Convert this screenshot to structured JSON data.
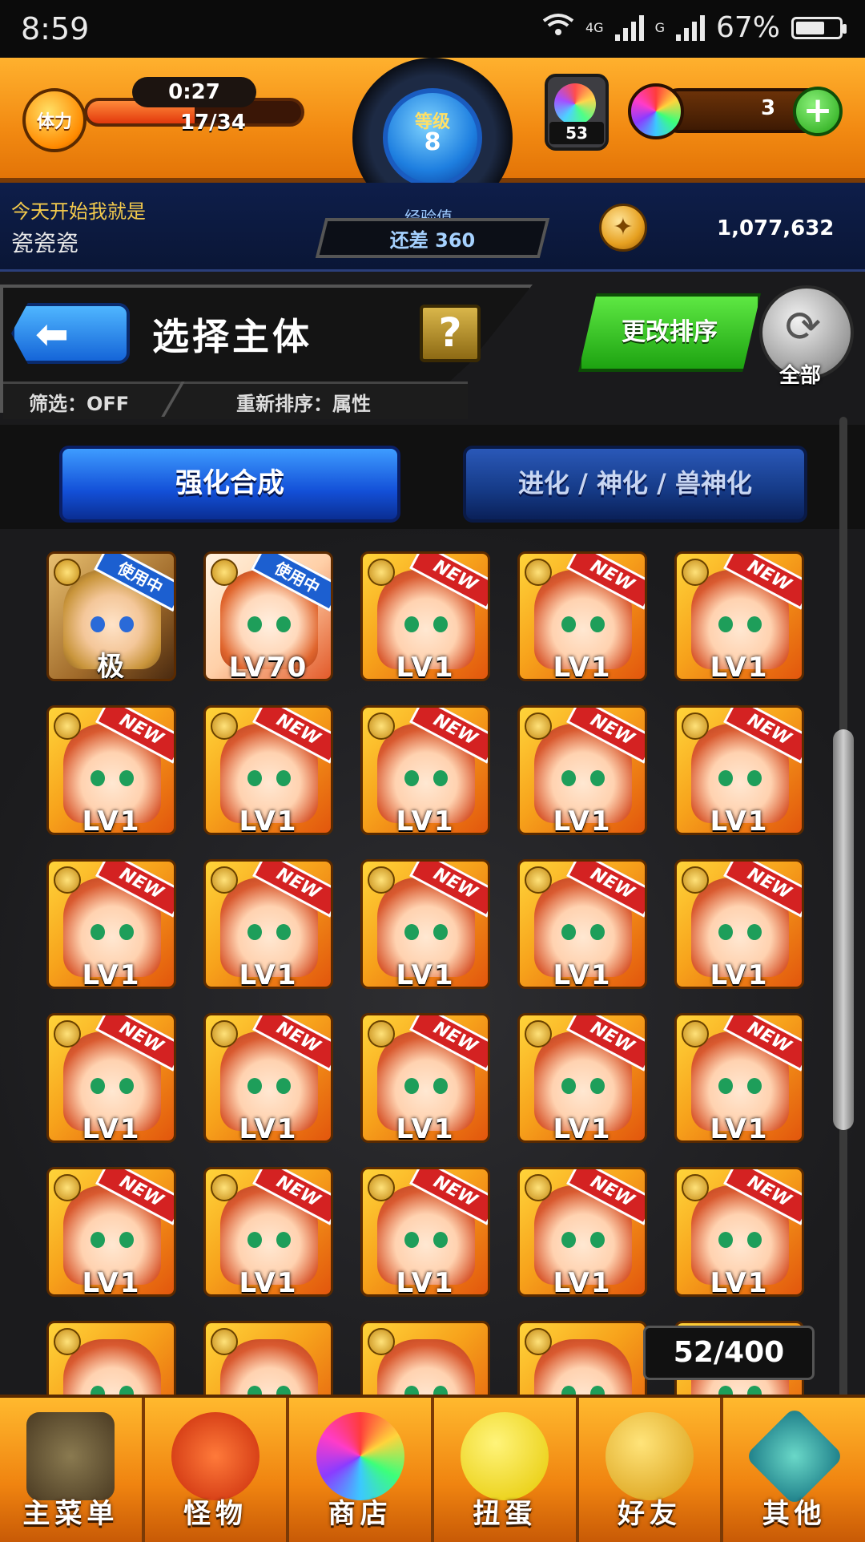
{
  "status_bar": {
    "time": "8:59",
    "network": "4G",
    "signal_label": "G",
    "battery": "67%",
    "battery_level": 0.67
  },
  "header": {
    "stamina_label": "体力",
    "stamina_timer": "0:27",
    "stamina": "17/34",
    "stamina_fraction": 0.5,
    "level_label": "等级",
    "level": "8",
    "exp_label": "经验值",
    "exp_remaining": "还差 360",
    "potion_count": "53",
    "orb_count": "3",
    "orb_add": "+",
    "coins": "1,077,632"
  },
  "profile": {
    "motto": "今天开始我就是",
    "name": "瓷瓷瓷"
  },
  "panel": {
    "back_icon": "back-arrow-icon",
    "title": "选择主体",
    "help": "?",
    "filter": "筛选：OFF",
    "sort": "重新排序：属性",
    "change_sort": "更改排序",
    "sort_all": "全部"
  },
  "modes": {
    "enhance": "强化合成",
    "evolve": "进化 / 神化 / 兽神化"
  },
  "grid": {
    "cards": [
      {
        "label": "极",
        "badge": "使用中",
        "type": "hero1"
      },
      {
        "label": "LV70",
        "badge": "使用中",
        "type": "hero2"
      },
      {
        "label": "LV1",
        "badge": "NEW"
      },
      {
        "label": "LV1",
        "badge": "NEW"
      },
      {
        "label": "LV1",
        "badge": "NEW"
      },
      {
        "label": "LV1",
        "badge": "NEW"
      },
      {
        "label": "LV1",
        "badge": "NEW"
      },
      {
        "label": "LV1",
        "badge": "NEW"
      },
      {
        "label": "LV1",
        "badge": "NEW"
      },
      {
        "label": "LV1",
        "badge": "NEW"
      },
      {
        "label": "LV1",
        "badge": "NEW"
      },
      {
        "label": "LV1",
        "badge": "NEW"
      },
      {
        "label": "LV1",
        "badge": "NEW"
      },
      {
        "label": "LV1",
        "badge": "NEW"
      },
      {
        "label": "LV1",
        "badge": "NEW"
      },
      {
        "label": "LV1",
        "badge": "NEW"
      },
      {
        "label": "LV1",
        "badge": "NEW"
      },
      {
        "label": "LV1",
        "badge": "NEW"
      },
      {
        "label": "LV1",
        "badge": "NEW"
      },
      {
        "label": "LV1",
        "badge": "NEW"
      },
      {
        "label": "LV1",
        "badge": "NEW"
      },
      {
        "label": "LV1",
        "badge": "NEW"
      },
      {
        "label": "LV1",
        "badge": "NEW"
      },
      {
        "label": "LV1",
        "badge": "NEW"
      },
      {
        "label": "LV1",
        "badge": "NEW"
      },
      {
        "label": "",
        "badge": ""
      },
      {
        "label": "",
        "badge": ""
      },
      {
        "label": "",
        "badge": ""
      },
      {
        "label": "",
        "badge": ""
      },
      {
        "label": "",
        "badge": ""
      }
    ],
    "box_count": "52/400"
  },
  "nav": [
    {
      "id": "home",
      "label": "主菜单",
      "icon": "gate-icon"
    },
    {
      "id": "monster",
      "label": "怪物",
      "icon": "monster-icon"
    },
    {
      "id": "shop",
      "label": "商店",
      "icon": "orb-icon"
    },
    {
      "id": "gacha",
      "label": "扭蛋",
      "icon": "egg-icon"
    },
    {
      "id": "friend",
      "label": "好友",
      "icon": "friends-icon"
    },
    {
      "id": "other",
      "label": "其他",
      "icon": "question-diamond-icon"
    }
  ]
}
